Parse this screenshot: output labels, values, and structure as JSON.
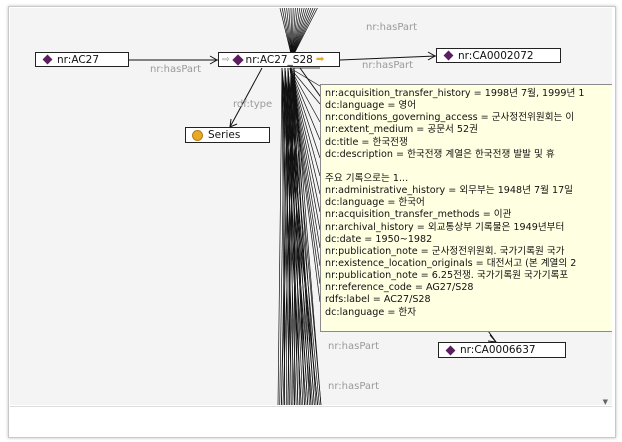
{
  "graph": {
    "nodes": {
      "ac27": {
        "label": "nr:AC27",
        "icon": "class-diamond-icon"
      },
      "ac27_s28": {
        "label": "nr:AC27_S28",
        "icon": "class-diamond-icon"
      },
      "ca0002072": {
        "label": "nr:CA0002072",
        "icon": "class-diamond-icon"
      },
      "series": {
        "label": "Series",
        "icon": "class-circle-icon"
      },
      "ca0006637": {
        "label": "nr:CA0006637",
        "icon": "class-diamond-icon"
      }
    },
    "edge_labels": {
      "haspart_left": "nr:hasPart",
      "haspart_top": "nr:hasPart",
      "haspart_right": "nr:hasPart",
      "rdf_type": "rdf:type",
      "haspart_lower1": "nr:hasPart",
      "haspart_lower2": "nr:hasPart"
    }
  },
  "tooltip": {
    "lines": [
      "nr:acquisition_transfer_history = 1998년 7월, 1999년 1",
      "dc:language = 영어",
      "nr:conditions_governing_access = 군사정전위원회는 이",
      "nr:extent_medium = 공문서 52권",
      "dc:title = 한국전쟁",
      "dc:description = 한국전쟁 계열은 한국전쟁 발발 및 휴",
      "",
      "주요 기록으로는 1...",
      "nr:administrative_history = 외무부는 1948년 7월 17일",
      "dc:language = 한국어",
      "nr:acquisition_transfer_methods = 이관",
      "nr:archival_history = 외교통상부 기록물은 1949년부터",
      "dc:date = 1950~1982",
      "nr:publication_note = 군사정전위원회. 국가기록원 국가",
      "nr:existence_location_originals = 대전서고 (본 계열의 2",
      "nr:publication_note = 6.25전쟁. 국가기록원 국가기록포",
      "nr:reference_code = AG27/S28",
      "rdfs:label = AC27/S28",
      "dc:language = 한자"
    ]
  },
  "colors": {
    "class_icon": "#5b1f5f",
    "instance_icon": "#e8a928",
    "tooltip_bg": "#ffffe1",
    "canvas_bg": "#f4f4f4"
  }
}
